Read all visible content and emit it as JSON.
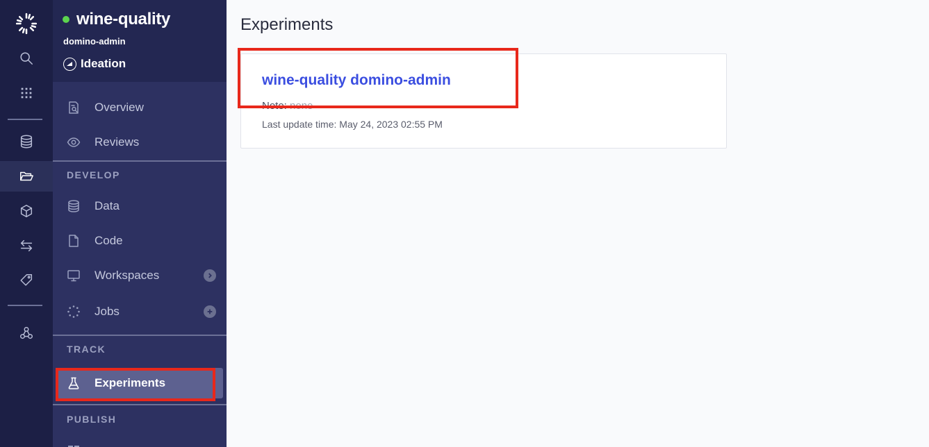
{
  "project": {
    "name": "wine-quality",
    "owner": "domino-admin",
    "stage": "Ideation",
    "status_color": "#5cd44e"
  },
  "rail": {
    "items": [
      "logo-icon",
      "search-icon",
      "apps-grid-icon",
      "database-icon",
      "folder-icon",
      "cube-icon",
      "exchange-icon",
      "tag-icon",
      "nodes-icon"
    ],
    "active": "folder-icon"
  },
  "sidebar": {
    "top_items": [
      {
        "label": "Overview",
        "icon": "overview-icon"
      },
      {
        "label": "Reviews",
        "icon": "eye-icon"
      }
    ],
    "sections": [
      {
        "label": "DEVELOP",
        "items": [
          {
            "label": "Data",
            "icon": "database-icon"
          },
          {
            "label": "Code",
            "icon": "file-icon"
          },
          {
            "label": "Workspaces",
            "icon": "monitor-icon",
            "trail": "chevron-right-icon"
          },
          {
            "label": "Jobs",
            "icon": "jobs-spinner-icon",
            "trail": "plus-icon"
          }
        ]
      },
      {
        "label": "TRACK",
        "items": [
          {
            "label": "Experiments",
            "icon": "flask-icon",
            "selected": true
          }
        ]
      },
      {
        "label": "PUBLISH",
        "items": []
      }
    ]
  },
  "main": {
    "title": "Experiments",
    "card": {
      "title": "wine-quality domino-admin",
      "note_label": "Note:",
      "note_value": "none",
      "updated": "Last update time: May 24, 2023 02:55 PM"
    }
  },
  "colors": {
    "highlight": "#e8281b",
    "link": "#3b4ee0",
    "sidebar_bg": "#2d3161",
    "rail_bg": "#1c1f45"
  }
}
